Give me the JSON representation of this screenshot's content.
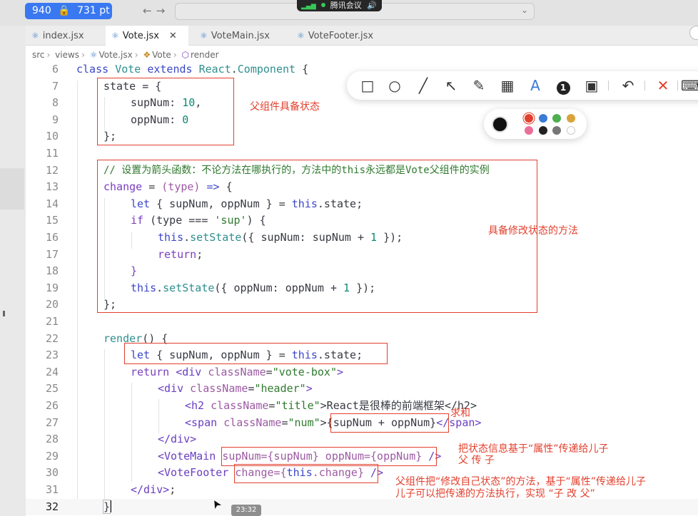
{
  "screen_size": {
    "width": "940",
    "height": "731",
    "unit": "pt"
  },
  "meeting": {
    "label": "腾讯会议"
  },
  "tabs": [
    {
      "label": "index.jsx",
      "active": false
    },
    {
      "label": "Vote.jsx",
      "active": true
    },
    {
      "label": "VoteMain.jsx",
      "active": false
    },
    {
      "label": "VoteFooter.jsx",
      "active": false
    }
  ],
  "breadcrumb": [
    "src",
    "views",
    "Vote.jsx",
    "Vote",
    "render"
  ],
  "line_numbers": [
    "6",
    "7",
    "8",
    "9",
    "10",
    "11",
    "12",
    "13",
    "14",
    "15",
    "16",
    "17",
    "18",
    "19",
    "20",
    "21",
    "22",
    "23",
    "24",
    "25",
    "26",
    "27",
    "28",
    "29",
    "30",
    "31",
    "32"
  ],
  "code": {
    "l6": [
      "class",
      "Vote",
      "extends",
      "React",
      ".",
      "Component",
      "{"
    ],
    "l7": [
      "state",
      "= {"
    ],
    "l8": [
      "supNum:",
      "10",
      ","
    ],
    "l9": [
      "oppNum:",
      "0"
    ],
    "l10": [
      "};"
    ],
    "l12": [
      "// 设置为箭头函数：不论方法在哪执行的，方法中的this永远都是Vote父组件的实例"
    ],
    "l13": [
      "change",
      "=",
      "(type)",
      "=>",
      "{"
    ],
    "l14": [
      "let",
      "{ supNum, oppNum } =",
      "this",
      ".state;"
    ],
    "l15": [
      "if",
      "(type === ",
      "'sup'",
      ") {"
    ],
    "l16": [
      "this",
      ".",
      "setState",
      "({ supNum: supNum + ",
      "1",
      " });"
    ],
    "l17": [
      "return",
      ";"
    ],
    "l18": [
      "}"
    ],
    "l19": [
      "this",
      ".",
      "setState",
      "({ oppNum: oppNum + ",
      "1",
      " });"
    ],
    "l20": [
      "};"
    ],
    "l22": [
      "render",
      "() {"
    ],
    "l23": [
      "let",
      "{ supNum, oppNum } =",
      "this",
      ".state;"
    ],
    "l24": [
      "return",
      "<div",
      "className",
      "=",
      "\"vote-box\"",
      ">"
    ],
    "l25": [
      "<div",
      "className",
      "=",
      "\"header\"",
      ">"
    ],
    "l26": [
      "<h2",
      "className",
      "=",
      "\"title\"",
      ">React是很棒的前端框架</h2>"
    ],
    "l27": [
      "<span",
      "className",
      "=",
      "\"num\"",
      ">{supNum + oppNum}",
      "</span>"
    ],
    "l28": [
      "</div>"
    ],
    "l29": [
      "<VoteMain",
      "supNum={supNum} oppNum={oppNum}",
      " />"
    ],
    "l30": [
      "<VoteFooter",
      "change={",
      "this",
      ".change}",
      " />"
    ],
    "l31": [
      "</div>",
      ";"
    ],
    "l32": [
      "}"
    ]
  },
  "annotations": {
    "state": "父组件具备状态",
    "method": "具备修改状态的方法",
    "sum": "求和",
    "props_line1": "把状态信息基于“属性”传递给儿子",
    "props_line2": "父 传 子",
    "footer_line1": "父组件把“修改自己状态”的方法，基于“属性”传递给儿子",
    "footer_line2": "儿子可以把传递的方法执行，实现 “子 改 父”"
  },
  "time_badge": "23:32",
  "colors": {
    "accent_blue": "#3a78f2",
    "annotation_red": "#e2402e",
    "palette": [
      "#e2402e",
      "#3a7bd5",
      "#4caf50",
      "#d9a33c",
      "#ea6f9a",
      "#222222",
      "#777777",
      "#ffffff"
    ]
  }
}
